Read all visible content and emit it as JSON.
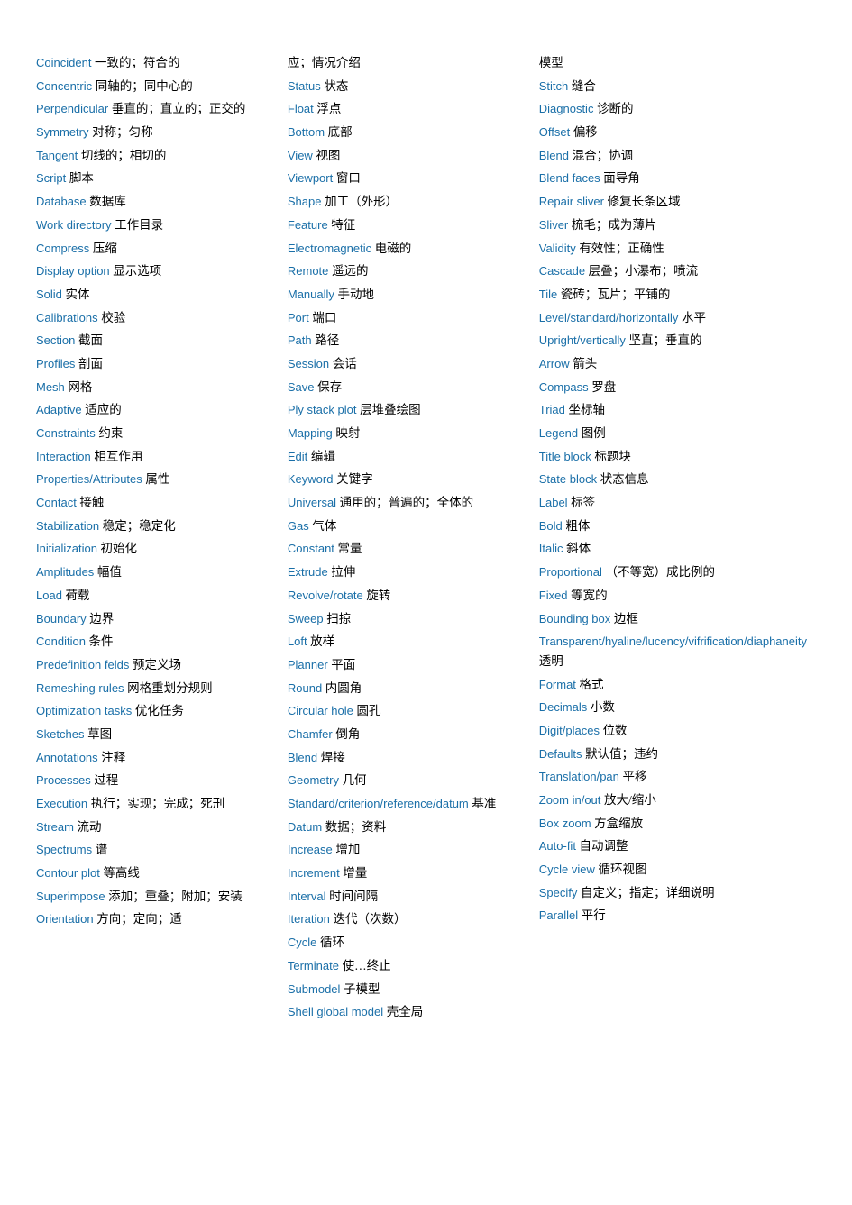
{
  "columns": [
    {
      "id": "col1",
      "entries": [
        {
          "en": "Coincident",
          "zh": "一致的；符合的"
        },
        {
          "en": "Concentric",
          "zh": "同轴的；同中心的"
        },
        {
          "en": "Perpendicular",
          "zh": "垂直的；直立的；正交的"
        },
        {
          "en": "Symmetry",
          "zh": "对称；匀称"
        },
        {
          "en": "Tangent",
          "zh": "切线的；相切的"
        },
        {
          "en": "Script",
          "zh": "脚本"
        },
        {
          "en": "Database",
          "zh": "数据库"
        },
        {
          "en": "Work directory",
          "zh": "工作目录"
        },
        {
          "en": "Compress",
          "zh": "压缩"
        },
        {
          "en": "Display option",
          "zh": "显示选项"
        },
        {
          "en": "Solid",
          "zh": "实体"
        },
        {
          "en": "Calibrations",
          "zh": "校验"
        },
        {
          "en": "Section",
          "zh": "截面"
        },
        {
          "en": "Profiles",
          "zh": "剖面"
        },
        {
          "en": "Mesh",
          "zh": "网格"
        },
        {
          "en": "Adaptive",
          "zh": "适应的"
        },
        {
          "en": "Constraints",
          "zh": "约束"
        },
        {
          "en": "Interaction",
          "zh": "相互作用"
        },
        {
          "en": "Properties/Attributes",
          "zh": "属性"
        },
        {
          "en": "Contact",
          "zh": "接触"
        },
        {
          "en": "Stabilization",
          "zh": "稳定；稳定化"
        },
        {
          "en": "Initialization",
          "zh": "初始化"
        },
        {
          "en": "Amplitudes",
          "zh": "幅值"
        },
        {
          "en": "Load",
          "zh": "荷载"
        },
        {
          "en": "Boundary",
          "zh": "边界"
        },
        {
          "en": "Condition",
          "zh": "条件"
        },
        {
          "en": "Predefinition felds",
          "zh": "预定义场"
        },
        {
          "en": "Remeshing rules",
          "zh": "网格重划分规则"
        },
        {
          "en": "Optimization tasks",
          "zh": "优化任务"
        },
        {
          "en": "Sketches",
          "zh": "草图"
        },
        {
          "en": "Annotations",
          "zh": "注释"
        },
        {
          "en": "Processes",
          "zh": "过程"
        },
        {
          "en": "Execution",
          "zh": "执行；实现；完成；死刑"
        },
        {
          "en": "Stream",
          "zh": "流动"
        },
        {
          "en": "Spectrums",
          "zh": "谱"
        },
        {
          "en": "Contour plot",
          "zh": "等高线"
        },
        {
          "en": "Superimpose",
          "zh": "添加；重叠；附加；安装"
        },
        {
          "en": "Orientation",
          "zh": "方向；定向；适"
        }
      ]
    },
    {
      "id": "col2",
      "entries": [
        {
          "en": "应；情况介绍",
          "zh": ""
        },
        {
          "en": "Status",
          "zh": "状态"
        },
        {
          "en": "Float",
          "zh": "浮点"
        },
        {
          "en": "Bottom",
          "zh": "底部"
        },
        {
          "en": "View",
          "zh": "视图"
        },
        {
          "en": "Viewport",
          "zh": "窗口"
        },
        {
          "en": "Shape",
          "zh": "加工（外形）"
        },
        {
          "en": "Feature",
          "zh": "特征"
        },
        {
          "en": "Electromagnetic",
          "zh": "电磁的"
        },
        {
          "en": "Remote",
          "zh": "遥远的"
        },
        {
          "en": "Manually",
          "zh": "手动地"
        },
        {
          "en": "Port",
          "zh": "端口"
        },
        {
          "en": "Path",
          "zh": "路径"
        },
        {
          "en": "Session",
          "zh": "会话"
        },
        {
          "en": "Save",
          "zh": "保存"
        },
        {
          "en": "Ply stack plot",
          "zh": "层堆叠绘图"
        },
        {
          "en": "Mapping",
          "zh": "映射"
        },
        {
          "en": "Edit",
          "zh": "编辑"
        },
        {
          "en": "Keyword",
          "zh": "关键字"
        },
        {
          "en": "Universal",
          "zh": "通用的；普遍的；全体的"
        },
        {
          "en": "Gas",
          "zh": "气体"
        },
        {
          "en": "Constant",
          "zh": "常量"
        },
        {
          "en": "Extrude",
          "zh": "拉伸"
        },
        {
          "en": "Revolve/rotate",
          "zh": "旋转"
        },
        {
          "en": "Sweep",
          "zh": "扫掠"
        },
        {
          "en": "Loft",
          "zh": "放样"
        },
        {
          "en": "Planner",
          "zh": "平面"
        },
        {
          "en": "Round",
          "zh": "内圆角"
        },
        {
          "en": "Circular hole",
          "zh": "圆孔"
        },
        {
          "en": "Chamfer",
          "zh": "倒角"
        },
        {
          "en": "Blend",
          "zh": "焊接"
        },
        {
          "en": "Geometry",
          "zh": "几何"
        },
        {
          "en": "Standard/criterion/reference/datum",
          "zh": "基准"
        },
        {
          "en": "Datum",
          "zh": "数据；资料"
        },
        {
          "en": "Increase",
          "zh": "增加"
        },
        {
          "en": "Increment",
          "zh": "增量"
        },
        {
          "en": "Interval",
          "zh": "时间间隔"
        },
        {
          "en": "Iteration",
          "zh": "迭代（次数）"
        },
        {
          "en": "Cycle",
          "zh": "循环"
        },
        {
          "en": "Terminate",
          "zh": "使…终止"
        },
        {
          "en": "Submodel",
          "zh": "子模型"
        },
        {
          "en": "Shell global model",
          "zh": "壳全局"
        }
      ]
    },
    {
      "id": "col3",
      "entries": [
        {
          "en": "模型",
          "zh": ""
        },
        {
          "en": "Stitch",
          "zh": "缝合"
        },
        {
          "en": "Diagnostic",
          "zh": "诊断的"
        },
        {
          "en": "Offset",
          "zh": "偏移"
        },
        {
          "en": "Blend",
          "zh": "混合；协调"
        },
        {
          "en": "Blend faces",
          "zh": "面导角"
        },
        {
          "en": "Repair sliver",
          "zh": "修复长条区域"
        },
        {
          "en": "Sliver",
          "zh": "梳毛；成为薄片"
        },
        {
          "en": "Validity",
          "zh": "有效性；正确性"
        },
        {
          "en": "Cascade",
          "zh": "层叠；小瀑布；喷流"
        },
        {
          "en": "Tile",
          "zh": "瓷砖；瓦片；平铺的"
        },
        {
          "en": "Level/standard/horizontally",
          "zh": "水平"
        },
        {
          "en": "Upright/vertically",
          "zh": "坚直；垂直的"
        },
        {
          "en": "Arrow",
          "zh": "箭头"
        },
        {
          "en": "Compass",
          "zh": "罗盘"
        },
        {
          "en": "Triad",
          "zh": "坐标轴"
        },
        {
          "en": "Legend",
          "zh": "图例"
        },
        {
          "en": "Title block",
          "zh": "标题块"
        },
        {
          "en": "State block",
          "zh": "状态信息"
        },
        {
          "en": "Label",
          "zh": "标签"
        },
        {
          "en": "Bold",
          "zh": "粗体"
        },
        {
          "en": "Italic",
          "zh": "斜体"
        },
        {
          "en": "Proportional",
          "zh": "（不等宽）成比例的"
        },
        {
          "en": "Fixed",
          "zh": "等宽的"
        },
        {
          "en": "Bounding box",
          "zh": "边框"
        },
        {
          "en": "Transparent/hyaline/lucency/vifrification/diaphaneity",
          "zh": "透明"
        },
        {
          "en": "Format",
          "zh": "格式"
        },
        {
          "en": "Decimals",
          "zh": "小数"
        },
        {
          "en": "Digit/places",
          "zh": "位数"
        },
        {
          "en": "Defaults",
          "zh": "默认值；违约"
        },
        {
          "en": "Translation/pan",
          "zh": "平移"
        },
        {
          "en": "Zoom in/out",
          "zh": "放大/缩小"
        },
        {
          "en": "Box zoom",
          "zh": "方盒缩放"
        },
        {
          "en": "Auto-fit",
          "zh": "自动调整"
        },
        {
          "en": "Cycle view",
          "zh": "循环视图"
        },
        {
          "en": "Specify",
          "zh": "自定义；指定；详细说明"
        },
        {
          "en": "Parallel",
          "zh": "平行"
        }
      ]
    }
  ]
}
